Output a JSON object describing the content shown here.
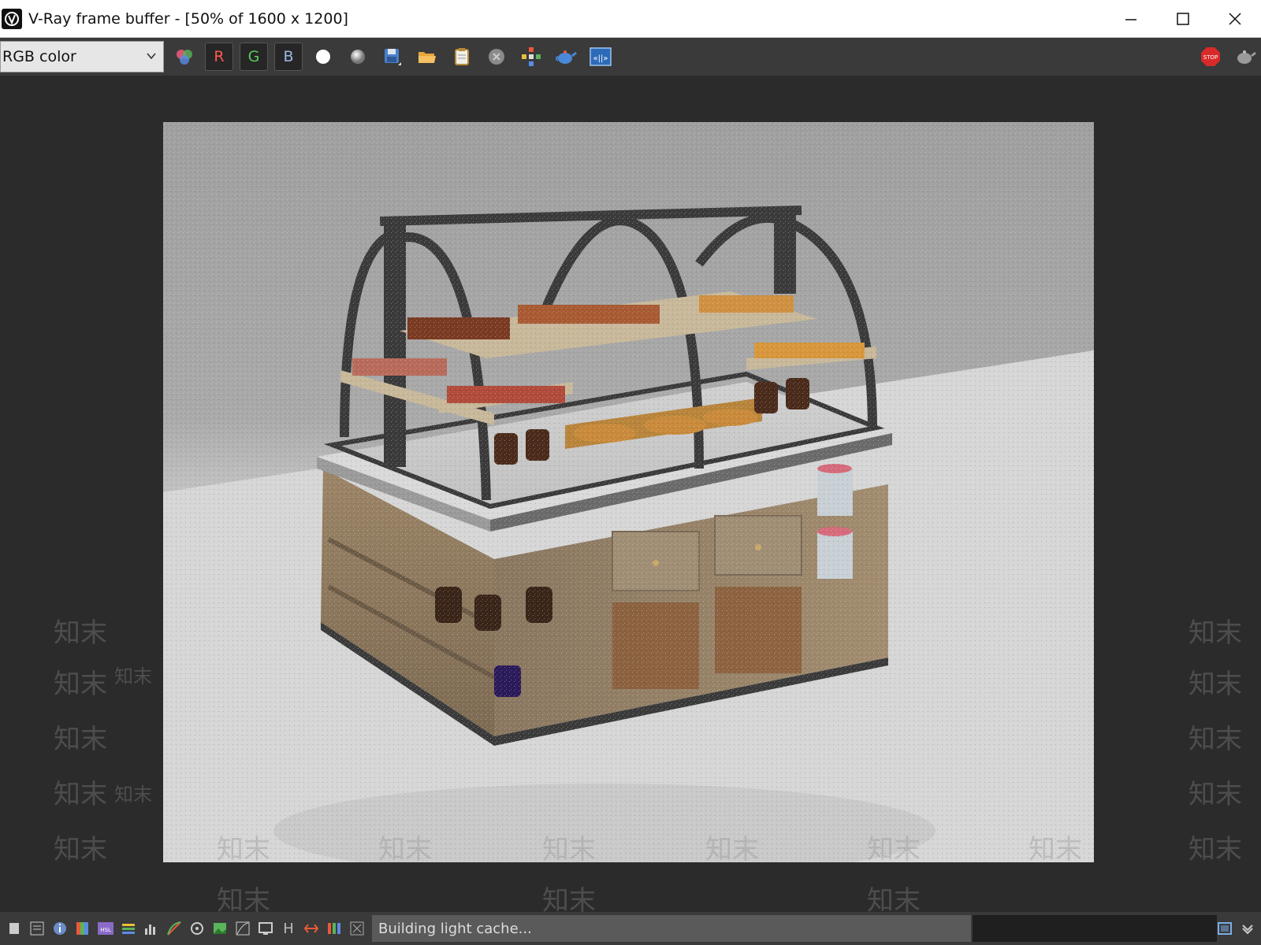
{
  "window": {
    "title": "V-Ray frame buffer - [50% of 1600 x 1200]",
    "minimize_icon": "minimize-icon",
    "maximize_icon": "maximize-icon",
    "close_icon": "close-icon"
  },
  "toolbar": {
    "channel_select": "RGB color",
    "red_label": "R",
    "green_label": "G",
    "blue_label": "B",
    "icons": [
      "color-wheel-icon",
      "white-circle-icon",
      "gray-sphere-icon",
      "save-icon",
      "open-folder-icon",
      "clipboard-icon",
      "clear-icon",
      "track-mouse-icon",
      "render-teapot-icon",
      "region-render-icon",
      "stop-icon",
      "render-last-icon"
    ],
    "colors": {
      "red": "#ff5a4d",
      "green": "#5ac85a",
      "blue": "#5a8ce6",
      "stop": "#d92a2a"
    }
  },
  "viewport": {
    "watermark": "知末",
    "render_description_icon": "bakery-display-render-image"
  },
  "statusbar": {
    "status_text": "Building light cache...",
    "h_label": "H"
  }
}
